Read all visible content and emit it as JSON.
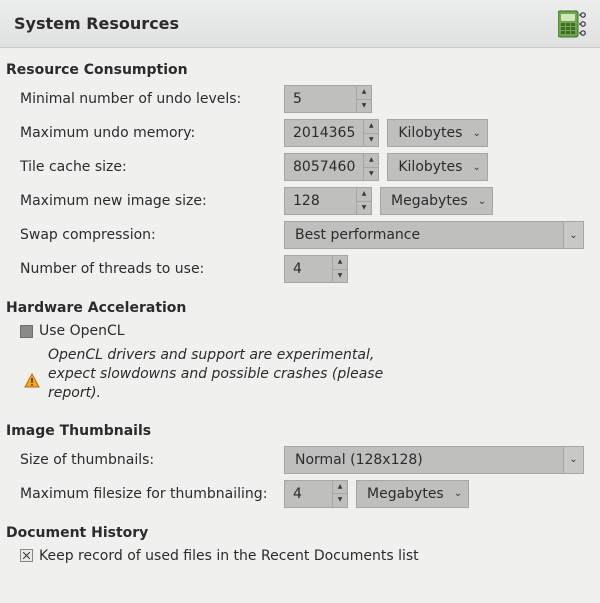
{
  "header": {
    "title": "System Resources"
  },
  "resource": {
    "title": "Resource Consumption",
    "undo_levels": {
      "label": "Minimal number of undo levels:",
      "value": "5"
    },
    "undo_memory": {
      "label": "Maximum undo memory:",
      "value": "2014365",
      "unit": "Kilobytes"
    },
    "tile_cache": {
      "label": "Tile cache size:",
      "value": "8057460",
      "unit": "Kilobytes"
    },
    "new_image": {
      "label": "Maximum new image size:",
      "value": "128",
      "unit": "Megabytes"
    },
    "swap": {
      "label": "Swap compression:",
      "value": "Best performance"
    },
    "threads": {
      "label": "Number of threads to use:",
      "value": "4"
    }
  },
  "accel": {
    "title": "Hardware Acceleration",
    "opencl_label": "Use OpenCL",
    "warning": "OpenCL drivers and support are experimental, expect slowdowns and possible crashes (please report)."
  },
  "thumbs": {
    "title": "Image Thumbnails",
    "size": {
      "label": "Size of thumbnails:",
      "value": "Normal (128x128)"
    },
    "maxfile": {
      "label": "Maximum filesize for thumbnailing:",
      "value": "4",
      "unit": "Megabytes"
    }
  },
  "history": {
    "title": "Document History",
    "keep_label": "Keep record of used files in the Recent Documents list"
  }
}
